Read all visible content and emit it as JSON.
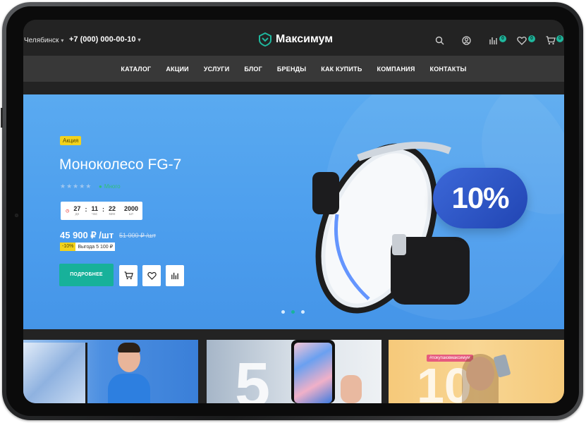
{
  "header": {
    "city": "Челябинск",
    "phone": "+7 (000) 000-00-10",
    "logo_text": "Максимум",
    "compare_count": "0",
    "favorites_count": "0",
    "cart_count": "0"
  },
  "nav": {
    "items": [
      "КАТАЛОГ",
      "АКЦИИ",
      "УСЛУГИ",
      "БЛОГ",
      "БРЕНДЫ",
      "КАК КУПИТЬ",
      "КОМПАНИЯ",
      "КОНТАКТЫ"
    ]
  },
  "hero": {
    "tag": "Акция",
    "title": "Моноколесо FG-7",
    "rating_stars": "★★★★★",
    "stock": "Много",
    "timer": {
      "days": "27",
      "days_label": "дн",
      "hours": "11",
      "hours_label": "час",
      "minutes": "22",
      "minutes_label": "мин",
      "count": "2000",
      "count_label": "шт"
    },
    "price": "45 900 ₽ /шт",
    "old_price": "51 000 ₽ /шт",
    "discount_percent": "-10%",
    "saving": "Выгода 5 100 ₽",
    "more_button": "ПОДРОБНЕЕ",
    "promo_badge": "10%",
    "slides_total": 3,
    "active_slide": 2
  },
  "colors": {
    "accent": "#17b19a",
    "hero_bg": "#4b9ded",
    "tag_yellow": "#f2d21c",
    "promo_badge": "#2a4fc0"
  },
  "cards": [
    {
      "name": "tv-promo-card"
    },
    {
      "name": "phone-promo-card"
    },
    {
      "name": "selfie-promo-card",
      "tag": "#покупаювмаксимум"
    }
  ]
}
